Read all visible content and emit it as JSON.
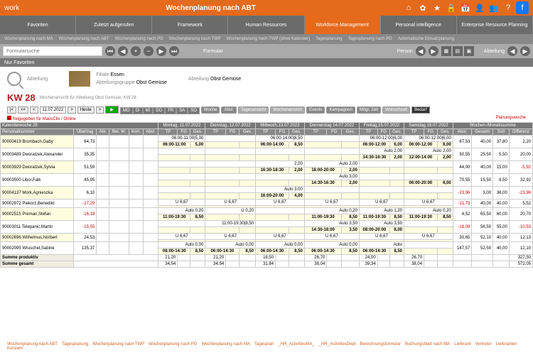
{
  "header": {
    "title": "Wochenplanung nach ABT",
    "app": "work"
  },
  "topIcons": [
    "⌂",
    "✿",
    "★",
    "🔒",
    "📅",
    "👤",
    "👥",
    "?"
  ],
  "navTabs": [
    {
      "l": "Favoriten"
    },
    {
      "l": "Zuletzt aufgerufen"
    },
    {
      "l": "Framework"
    },
    {
      "l": "Human Resources"
    },
    {
      "l": "Workforce Management",
      "a": true
    },
    {
      "l": "Personal intelligence"
    },
    {
      "l": "Enterprise Resource Planning"
    }
  ],
  "subTabs": [
    "Wochenplanung nach MA",
    "Wochenplanung nach ABT",
    "Wochenplanung nach PG",
    "Wochenplanung nach TWP",
    "Wochenplanung nach TWP (ohne Kalender)",
    "Tagesplanung",
    "Tagesplanung nach PG",
    "Automatische Einsatzplanung"
  ],
  "search": {
    "ph": "Formularsuche",
    "fav": "Nur Favoriten",
    "lbl1": "Formular",
    "lbl2": "Person",
    "lbl3": "Abteilung"
  },
  "filter": {
    "abt": "Abteilung",
    "fil": "Filiale",
    "filv": "Essen",
    "grp": "Abteilungsgruppe",
    "grpv": "Obst Gemüse",
    "abt2": "Abteilung",
    "abt2v": "Obst Gemüse"
  },
  "kw": {
    "big": "KW 28",
    "sub": "Wochenansicht für Abteilung Obst Gemüse, KW 28"
  },
  "ctrl": {
    "date": "11.07.2022",
    "heute": "Heute",
    "days": [
      "MO",
      "DI",
      "MI",
      "DO",
      "FR",
      "SA",
      "SO"
    ],
    "b1": "Woche",
    "b2": "Abst.",
    "b3": "Tagesansicht",
    "b4": "Wochenansicht",
    "b5": "Events",
    "b6": "Kampagnen",
    "b7": "Mögl. Zeit",
    "b8": "Wunschzeit",
    "b9": "Bedarf"
  },
  "status": {
    "s1": "freigegeben für MausClix / Online",
    "s2": "Planungswoche"
  },
  "cols": {
    "kw": "Kalenderwoche 28",
    "pn": "Personalnummer",
    "ub": "Übertrag",
    "abr": "Abr.",
    "bw": "Ber. W.",
    "korr": "Korr.",
    "abst": "Abst.",
    "days": [
      "Montag, 11.07.2022",
      "Dienstag, 12.07.2022",
      "Mittwoch,13.07.2022",
      "Donnerstag 14.07.2022",
      "Freitag,15.07.2022",
      "Samstag 16.07.2022"
    ],
    "sub": [
      "TP",
      "FG",
      "Ges."
    ],
    "wm": "Wochen-/Monatssumme",
    "wmsub": [
      "Abst.",
      "Gesamt",
      "Soll",
      "Differenz"
    ]
  },
  "rows": [
    {
      "pn": "90000419 Brombach,Gaby",
      "ub": "64,73",
      "d": [
        [
          "Auto",
          "",
          "5,00",
          "Auto",
          "",
          "5,00"
        ],
        [
          "Auto",
          "",
          "",
          "",
          "",
          ""
        ],
        [
          "",
          "",
          "",
          "",
          "",
          ""
        ],
        [
          "",
          "",
          "",
          "Auto",
          "",
          "5,00",
          "Auto",
          "",
          "5,00"
        ],
        [
          "",
          "",
          "",
          "",
          "",
          ""
        ]
      ],
      "t": [
        "06:00-11:00|5,00",
        "",
        "06:00-14:00|8,50",
        "",
        "06:00-12:00|6,00",
        "06:00-12:00|6,00"
      ],
      "wm": [
        "67,53",
        "40,00",
        "37,80",
        "2,20"
      ]
    },
    {
      "pn": "90003489 Dworatzek,Alexander",
      "ub": "35,35",
      "t": [
        "",
        "",
        "",
        "",
        "Auto 2,00",
        "Auto 2,00"
      ],
      "t2": [
        "",
        "",
        "",
        "",
        "14:30-16:30|2,00",
        "12:00-14:00|2,00"
      ],
      "wm": [
        "50,55",
        "25,50",
        "5,50",
        "20,00"
      ]
    },
    {
      "pn": "90003929 Dworatzek,Sylvia",
      "ub": "51,59",
      "t": [
        "",
        "",
        "2,00",
        "Auto 2,00",
        "",
        ""
      ],
      "t2": [
        "",
        "",
        "16:30-18:30|2,00",
        "18:00-20:00|2,00",
        "",
        ""
      ],
      "wm": [
        "44,00",
        "40,00",
        "15,00",
        "-5,92"
      ]
    },
    {
      "pn": "90003500 Libor,Falk",
      "ub": "45,95",
      "t": [
        "",
        "",
        "",
        "Auto 3,00",
        "",
        ""
      ],
      "t2": [
        "",
        "",
        "",
        "14:30-16:30|2,00",
        "",
        "06:00-20:00|6,00"
      ],
      "wm": [
        "70,55",
        "15,50",
        "8,50",
        "32,92"
      ]
    },
    {
      "pn": "90004137 Mork,Agnieszka",
      "ub": "6,10",
      "t": [
        "",
        "",
        "Auto 3,00",
        "",
        "",
        ""
      ],
      "t2": [
        "",
        "",
        "16:00-20:00|4,00",
        "",
        "",
        ""
      ],
      "wm": [
        "-23,96",
        "3,00",
        "36,00",
        "-23,96"
      ],
      "neg": true
    },
    {
      "pn": "90002972 Piekorz,Benedikt",
      "ub": "-17,29",
      "neg0": true,
      "d6": [
        "U 6,67",
        "U 6,67",
        "U 6,67",
        "U 6,67",
        "U 6,67",
        "U 6,67"
      ],
      "wm": [
        "-11,73",
        "40,00",
        "40,00",
        "5,52"
      ]
    },
    {
      "pn": "90002515 Preman,Stefan",
      "ub": "-16,18",
      "neg0": true,
      "t": [
        "Auto 0,20",
        "U 0,20",
        "",
        "Auto 0,20",
        "Auto 1,20",
        "Auto 0,20"
      ],
      "t2": [
        "11:00-19:30|8,50",
        "",
        "",
        "11:00-19:30|8,50",
        "11:00-19:30|8,50",
        "11:00-19:30|8,50"
      ],
      "wm": [
        "4,52",
        "65,50",
        "60,00",
        "20,70"
      ]
    },
    {
      "pn": "90003011 Telepanic,Martin",
      "ub": "-15,55",
      "neg0": true,
      "t": [
        "",
        "11:00-19:30|8,50",
        "",
        "Auto 3,50",
        "Auto 3,50",
        ""
      ],
      "t2": [
        "",
        "",
        "",
        "14:30-18:00|3,50",
        "08:00-20:00|8,00",
        ""
      ],
      "wm": [
        "-18,08",
        "56,50",
        "55,00",
        "-10,53"
      ],
      "neg": true
    },
    {
      "pn": "90002696 Wilhelmus,Norbert",
      "ub": "24,53",
      "d6": [
        "U 6,67",
        "U 6,67",
        "U 6,67",
        "U 6,67",
        "U 6,67",
        "U 6,67"
      ],
      "wm": [
        "30,65",
        "52,10",
        "40,00",
        "12,13"
      ]
    },
    {
      "pn": "90002095 Wruschel,Sabine",
      "ub": "135,37",
      "t": [
        "Auto 0,00",
        "Auto 0,00",
        "Auto 0,00",
        "Auto 0,00",
        "Auto ",
        ""
      ],
      "t2": [
        "06:00-14:30|8,50",
        "06:00-14:30|8,50",
        "06:00-14:30|8,50",
        "06:00-14:30|8,50",
        "06:00-14:30|8,50",
        ""
      ],
      "wm": [
        "147,57",
        "52,50",
        "40,00",
        "12,10"
      ]
    }
  ],
  "sums": [
    {
      "l": "Summe produktiv",
      "v": [
        "21,20",
        "",
        "21,20",
        "",
        "18,50",
        "",
        "26,70",
        "",
        "24,00",
        "",
        "26,70",
        "",
        "",
        " ",
        "327,50"
      ]
    },
    {
      "l": "Summe gesamt",
      "v": [
        "34,54",
        "",
        "34,54",
        "",
        "31,84",
        "",
        "38,04",
        "",
        "39,34",
        "",
        "38,04",
        "",
        "",
        "",
        "572,05"
      ]
    }
  ],
  "footer": [
    "Wochenplanung nach ABT",
    "Tagesplanung",
    "Wochenplanung nach TWP",
    "Wochenplanung nach PG",
    "Wochenplanung nach MA",
    "Tagesplan",
    "_HR_ActivitiesMA_",
    "_HR_ActivitiesDept",
    "Berechnungsformular",
    "Buchungsblatt nach MA",
    "Lieferant",
    "Vertreter",
    "Lieferanten Konzern"
  ]
}
